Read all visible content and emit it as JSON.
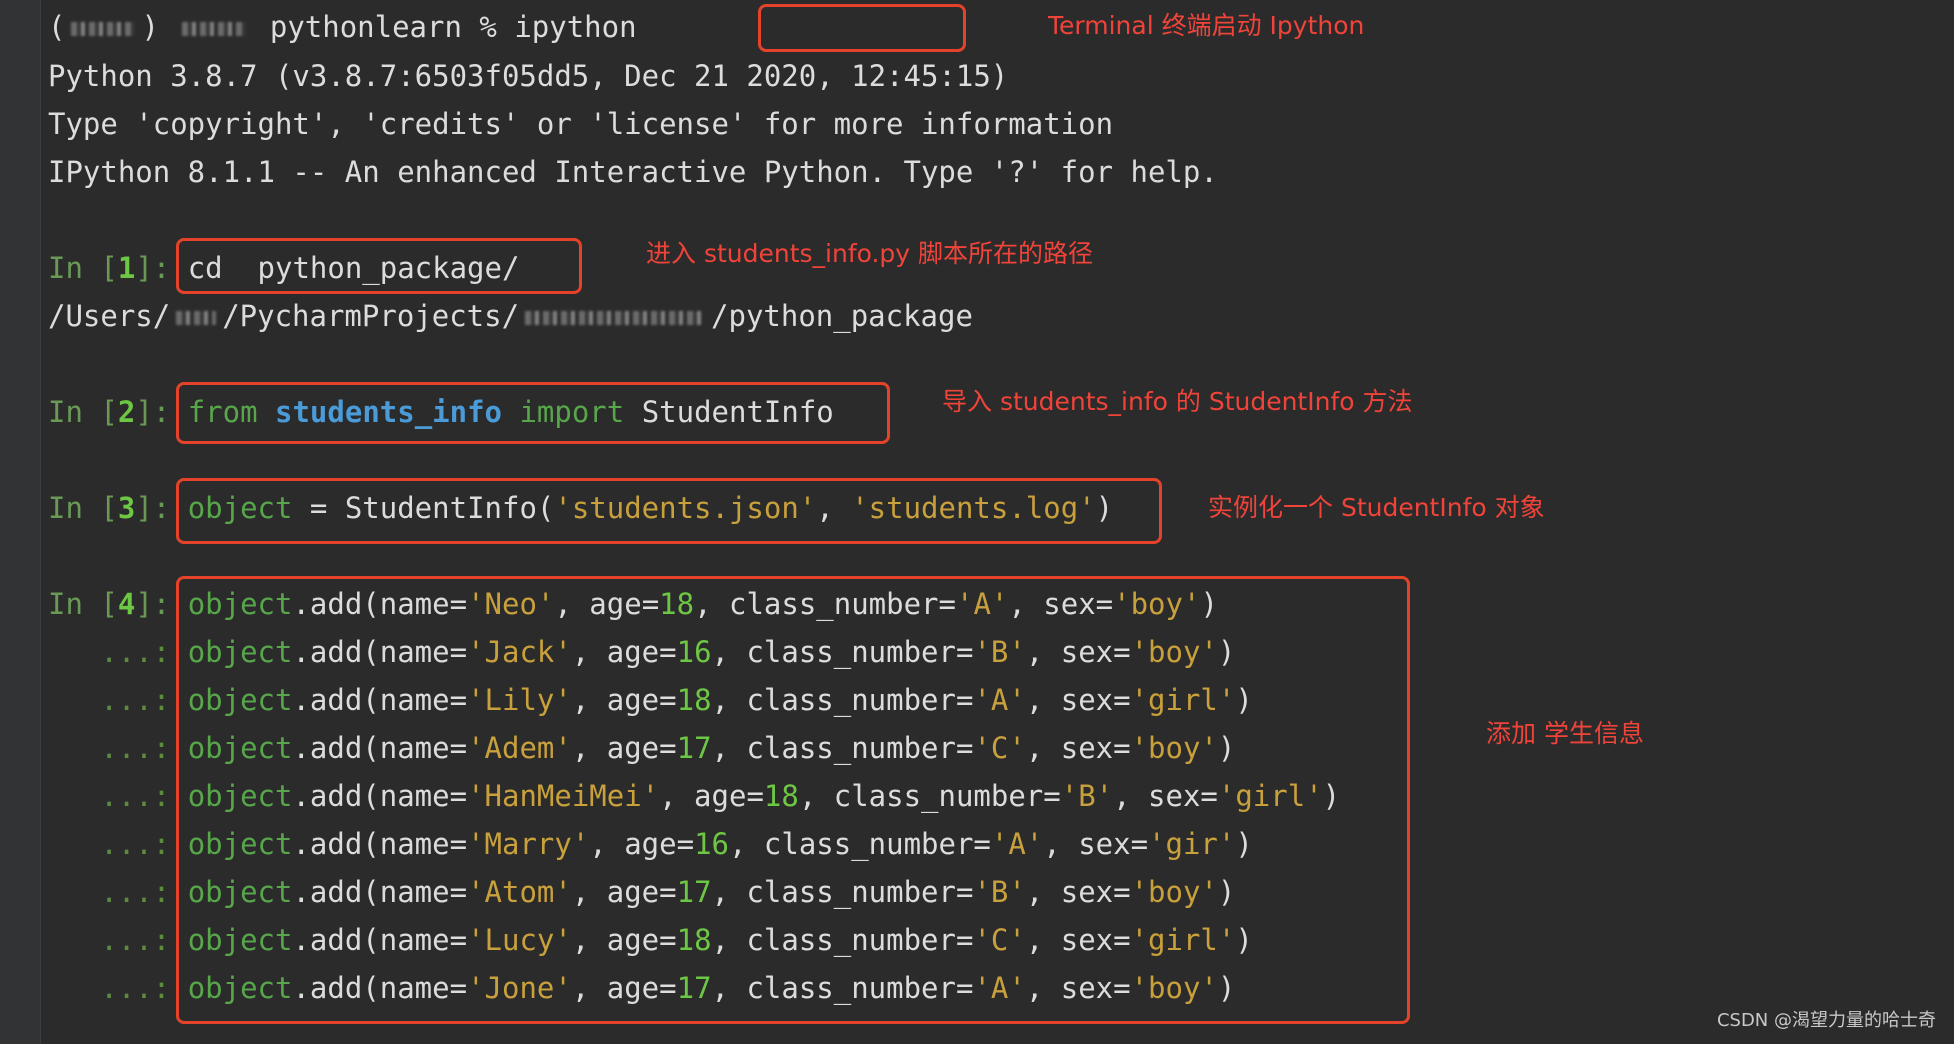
{
  "terminal": {
    "prompt_tail": "pythonlearn %",
    "command": "ipython",
    "banner": [
      "Python 3.8.7 (v3.8.7:6503f05dd5, Dec 21 2020, 12:45:15)",
      "Type 'copyright', 'credits' or 'license' for more information",
      "IPython 8.1.1 -- An enhanced Interactive Python. Type '?' for help."
    ],
    "in1": {
      "label": "In [",
      "num": "1",
      "end": "]:",
      "code": "cd  python_package/"
    },
    "path_out": {
      "prefix": "/Users/",
      "middle": "/PycharmProjects/",
      "suffix": "/python_package"
    },
    "in2": {
      "label": "In [",
      "num": "2",
      "end": "]:",
      "from": "from",
      "module": "students_info",
      "import": "import",
      "name": "StudentInfo"
    },
    "in3": {
      "label": "In [",
      "num": "3",
      "end": "]:",
      "var": "object",
      "eq": " = StudentInfo(",
      "arg1": "'students.json'",
      "sep": ", ",
      "arg2": "'students.log'",
      "close": ")"
    },
    "in4": {
      "label": "In [",
      "num": "4",
      "end": "]:",
      "cont": "...:"
    },
    "students": [
      {
        "name": "'Neo'",
        "age": "18",
        "cls": "'A'",
        "sex": "'boy'"
      },
      {
        "name": "'Jack'",
        "age": "16",
        "cls": "'B'",
        "sex": "'boy'"
      },
      {
        "name": "'Lily'",
        "age": "18",
        "cls": "'A'",
        "sex": "'girl'"
      },
      {
        "name": "'Adem'",
        "age": "17",
        "cls": "'C'",
        "sex": "'boy'"
      },
      {
        "name": "'HanMeiMei'",
        "age": "18",
        "cls": "'B'",
        "sex": "'girl'"
      },
      {
        "name": "'Marry'",
        "age": "16",
        "cls": "'A'",
        "sex": "'gir'"
      },
      {
        "name": "'Atom'",
        "age": "17",
        "cls": "'B'",
        "sex": "'boy'"
      },
      {
        "name": "'Lucy'",
        "age": "18",
        "cls": "'C'",
        "sex": "'girl'"
      },
      {
        "name": "'Jone'",
        "age": "17",
        "cls": "'A'",
        "sex": "'boy'"
      }
    ],
    "code_parts": {
      "obj": "object",
      "add": ".add(name=",
      "age": ", age=",
      "cls": ", class_number=",
      "sex": ", sex=",
      "close": ")"
    }
  },
  "annotations": {
    "terminal_launch": "Terminal 终端启动 Ipython",
    "enter_path": "进入 students_info.py 脚本所在的路径",
    "import_method": "导入 students_info 的 StudentInfo 方法",
    "instantiate": "实例化一个 StudentInfo 对象",
    "add_info": "添加 学生信息"
  },
  "watermark": "CSDN @渴望力量的哈士奇",
  "colors": {
    "accent_box": "#e4432a",
    "annotation_text": "#f0443a",
    "background": "#2b2b2b"
  }
}
